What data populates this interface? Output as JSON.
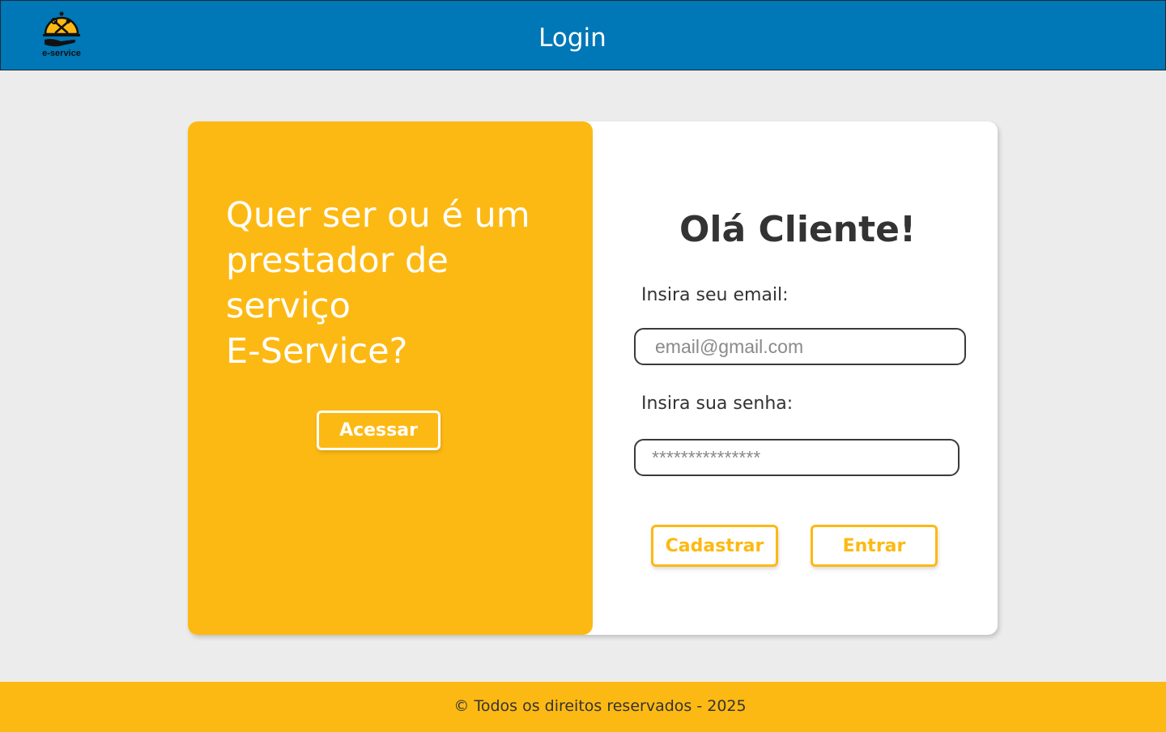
{
  "header": {
    "title": "Login",
    "logo_text": "e-service",
    "logo_icon": "tools-cloche-icon"
  },
  "promo": {
    "lines": [
      "Quer ser ou é um",
      "prestador de",
      "serviço",
      "E-Service?"
    ],
    "button_label": "Acessar"
  },
  "login": {
    "greeting": "Olá Cliente!",
    "email_label": "Insira seu email:",
    "email_placeholder": "email@gmail.com",
    "password_label": "Insira sua senha:",
    "password_placeholder": "***************",
    "register_label": "Cadastrar",
    "submit_label": "Entrar"
  },
  "footer": {
    "text": "© Todos os direitos reservados - 2025"
  },
  "colors": {
    "header_blue": "#0077b6",
    "accent_yellow": "#fdb913",
    "background": "#ececec",
    "text_dark": "#333333"
  }
}
